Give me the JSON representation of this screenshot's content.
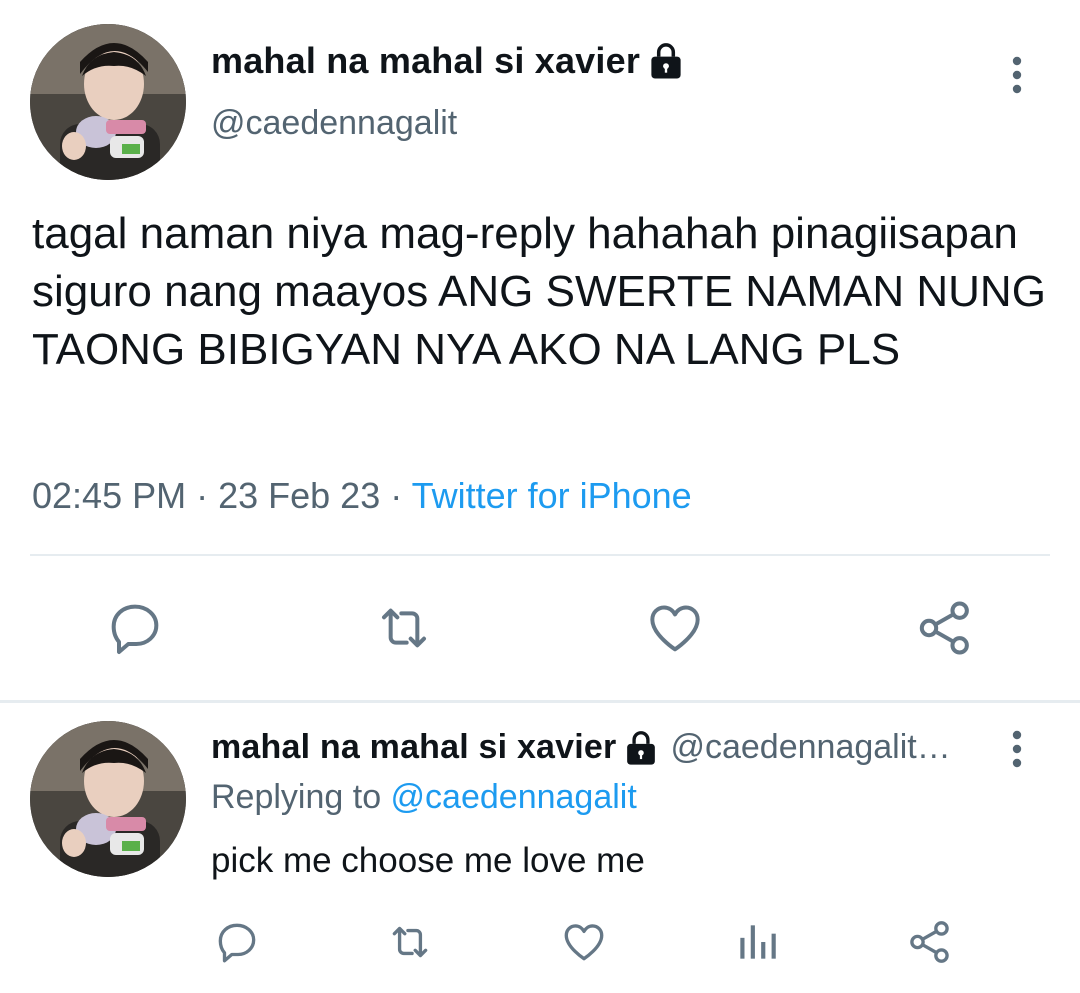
{
  "main_tweet": {
    "display_name": "mahal na mahal si xavier",
    "handle": "@caedennagalit",
    "text": "tagal naman niya mag-reply hahahah pinagiisapan siguro nang maayos ANG SWERTE NAMAN NUNG TAONG BIBIGYAN NYA AKO NA LANG PLS",
    "time": "02:45 PM",
    "dot1": " · ",
    "date": "23 Feb 23",
    "dot2": " · ",
    "source": "Twitter for iPhone",
    "actions": [
      "reply-icon",
      "retweet-icon",
      "like-icon",
      "share-icon"
    ]
  },
  "reply_tweet": {
    "display_name": "mahal na mahal si xavier",
    "handle": "@caedennagalit…",
    "replying_prefix": "Replying to ",
    "replying_to": "@caedennagalit",
    "text": "pick me choose me love me",
    "actions": [
      "reply-icon",
      "retweet-icon",
      "like-icon",
      "analytics-icon",
      "share-icon"
    ]
  },
  "colors": {
    "text_primary": "#0f1419",
    "text_secondary": "#536471",
    "accent_blue": "#1d9bf0",
    "icon_gray": "#657786",
    "divider": "#e6ecf0"
  }
}
